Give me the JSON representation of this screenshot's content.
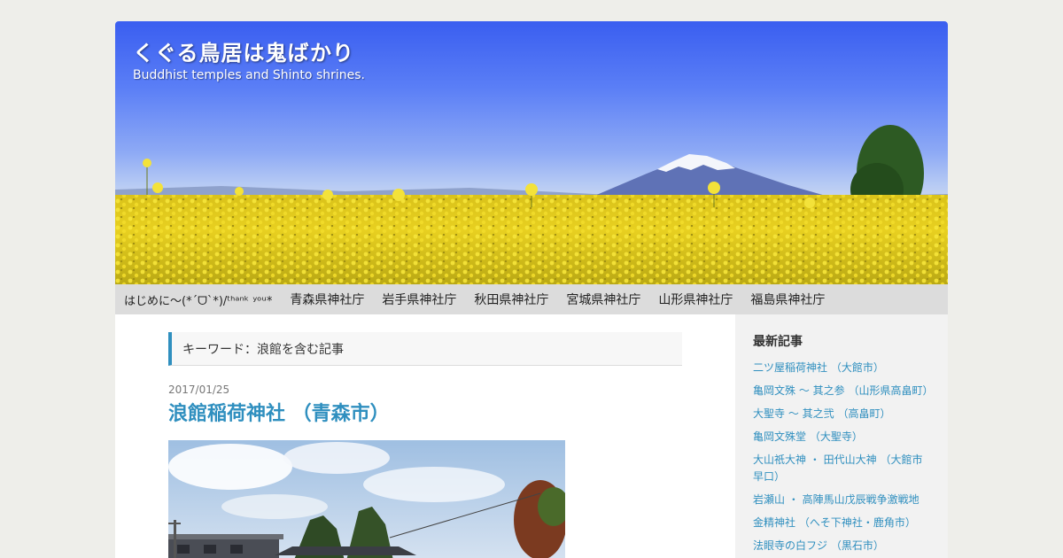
{
  "header": {
    "title": "くぐる鳥居は鬼ばかり",
    "description": "Buddhist temples and Shinto shrines."
  },
  "nav": {
    "items": [
      "はじめに～(*´ᗜ`*)/ᵗʰᵃⁿᵏ ʸᵒᵘ*",
      "青森県神社庁",
      "岩手県神社庁",
      "秋田県神社庁",
      "宮城県神社庁",
      "山形県神社庁",
      "福島県神社庁"
    ]
  },
  "main": {
    "keyword_heading": "キーワード：浪館を含む記事",
    "post": {
      "date": "2017/01/25",
      "title": "浪館稲荷神社 （青森市）"
    }
  },
  "sidebar": {
    "heading": "最新記事",
    "items": [
      "二ツ屋稲荷神社 （大館市）",
      "亀岡文殊 ～ 其之参 （山形県高畠町）",
      "大聖寺 ～ 其之弐 （高畠町）",
      "亀岡文殊堂 （大聖寺）",
      "大山祇大神 ・ 田代山大神 （大館市早口）",
      "岩瀬山 ・ 高陣馬山戊辰戦争激戦地",
      "金精神社 （へそ下神社・鹿角市）",
      "法眼寺の白フジ （黒石市）"
    ]
  },
  "colors": {
    "accent": "#2f8fbf",
    "nav_bg": "#dcdcdc",
    "sidebar_bg": "#f2f2f2"
  }
}
